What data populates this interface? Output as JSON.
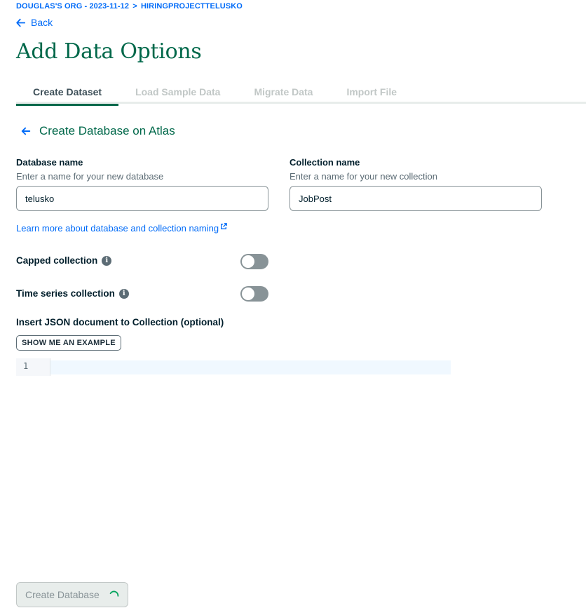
{
  "breadcrumb": {
    "org": "DOUGLAS'S ORG - 2023-11-12",
    "separator": ">",
    "project": "HIRINGPROJECTTELUSKO"
  },
  "back_label": "Back",
  "page_title": "Add Data Options",
  "tabs": [
    {
      "label": "Create Dataset",
      "active": true
    },
    {
      "label": "Load Sample Data",
      "active": false
    },
    {
      "label": "Migrate Data",
      "active": false
    },
    {
      "label": "Import File",
      "active": false
    }
  ],
  "section_title": "Create Database on Atlas",
  "database": {
    "label": "Database name",
    "description": "Enter a name for your new database",
    "value": "telusko"
  },
  "collection": {
    "label": "Collection name",
    "description": "Enter a name for your new collection",
    "value": "JobPost"
  },
  "learn_more": "Learn more about database and collection naming",
  "capped": {
    "label": "Capped collection",
    "enabled": false
  },
  "time_series": {
    "label": "Time series collection",
    "enabled": false
  },
  "json_label": "Insert JSON document to Collection (optional)",
  "example_button": "SHOW ME AN EXAMPLE",
  "editor": {
    "line_number": "1",
    "content": ""
  },
  "create_button": "Create Database",
  "colors": {
    "accent_green": "#00684a",
    "link_blue": "#016bf8",
    "toggle_off": "#889397"
  },
  "icons": [
    "arrow-left-icon",
    "external-link-icon",
    "info-icon",
    "spinner-icon"
  ]
}
